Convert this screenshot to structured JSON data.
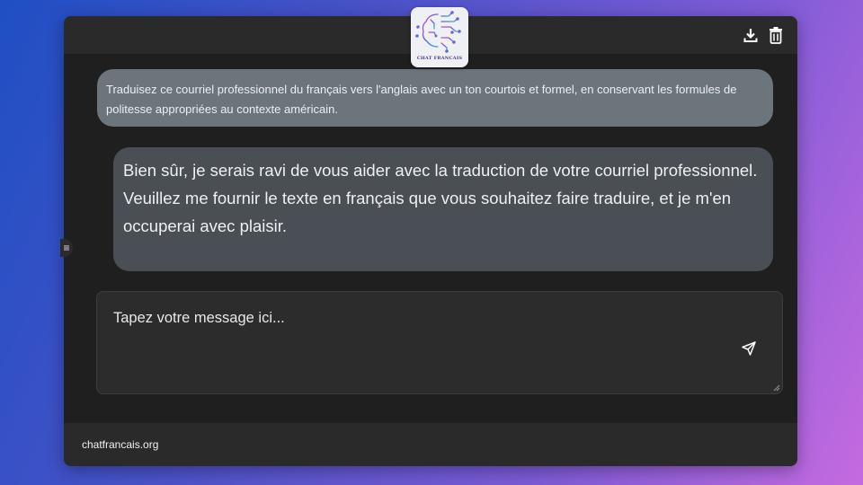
{
  "app": {
    "logo_text": "CHAT FRANCAIS",
    "logo_icon": "circuit-brain-icon"
  },
  "toolbar": {
    "download_icon": "download-icon",
    "delete_icon": "trash-icon"
  },
  "conversation": {
    "messages": [
      {
        "role": "user",
        "text": "Traduisez ce courriel professionnel du français vers l'anglais avec un ton courtois et formel, en conservant les formules de politesse appropriées au contexte américain."
      },
      {
        "role": "assistant",
        "text": "Bien sûr, je serais ravi de vous aider avec la traduction de votre courriel professionnel. Veuillez me fournir le texte en français que vous souhaitez faire traduire, et je m'en occuperai avec plaisir."
      }
    ]
  },
  "sidebar_toggle": {
    "label": "≡"
  },
  "composer": {
    "placeholder": "Tapez votre message ici...",
    "value": "",
    "send_icon": "send-icon"
  },
  "footer": {
    "link_text": "chatfrancais.org"
  },
  "colors": {
    "background_gradient_start": "#1f4fc4",
    "background_gradient_end": "#c56ae0",
    "window_bg": "#1f1f1f",
    "bar_bg": "#2a2a2a",
    "user_bubble": "#6c747c",
    "assistant_bubble": "#4a4f55"
  }
}
